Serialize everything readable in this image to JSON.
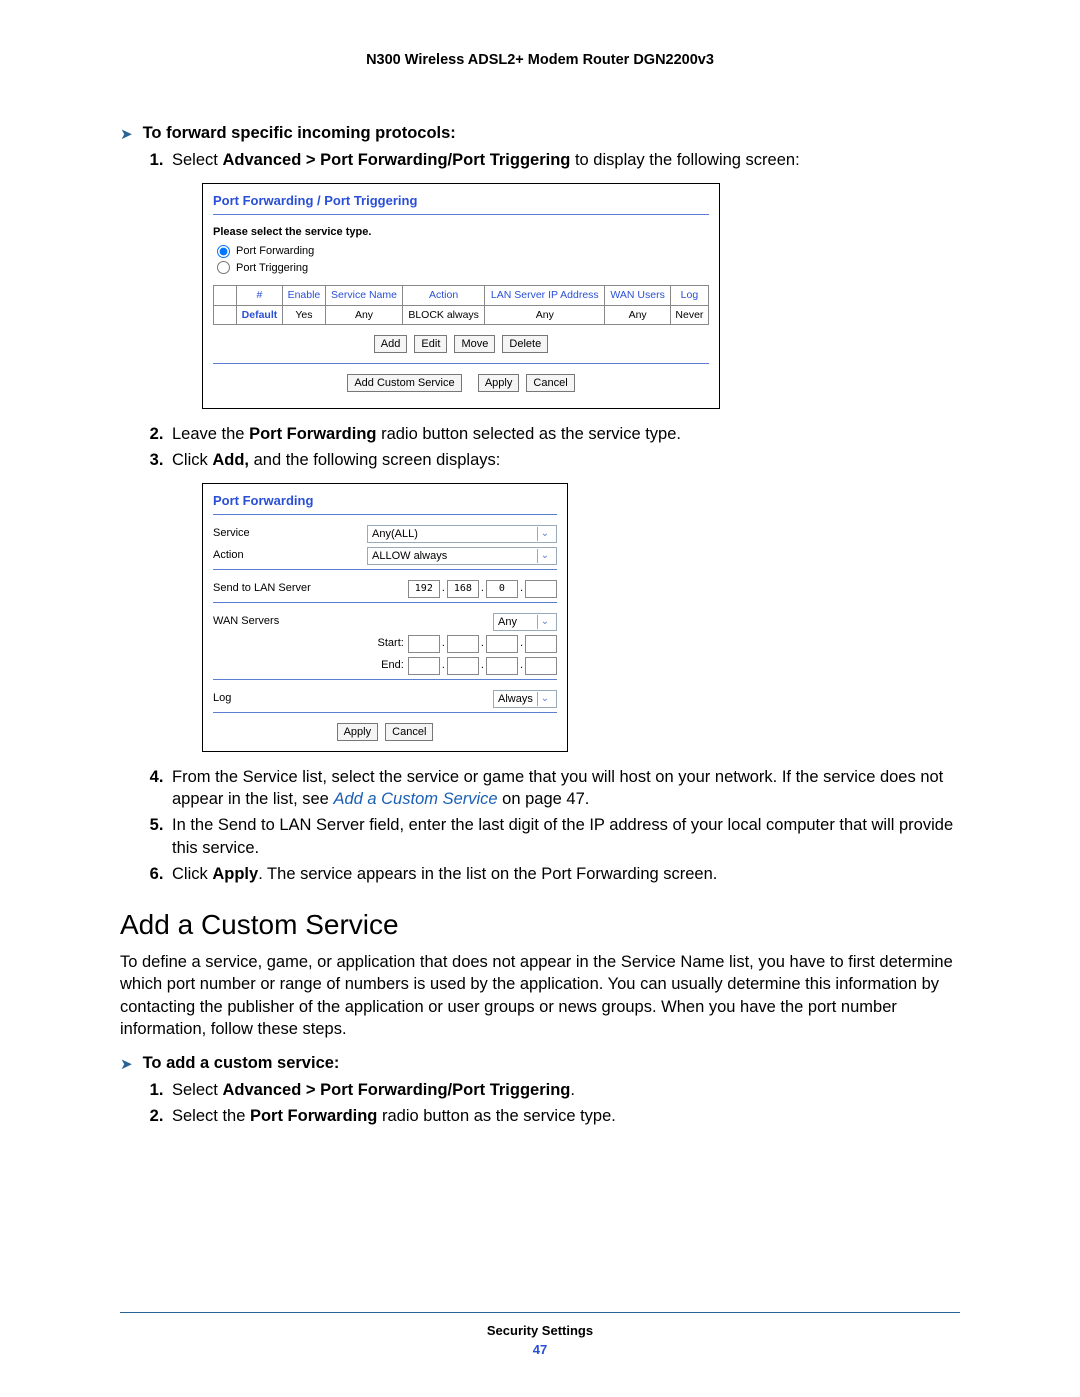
{
  "header": {
    "title": "N300 Wireless ADSL2+ Modem Router DGN2200v3"
  },
  "sec1": {
    "heading": "To forward specific incoming protocols:",
    "step1_a": "Select ",
    "step1_b": "Advanced > Port Forwarding/Port Triggering",
    "step1_c": " to display the following screen:",
    "step2_a": "Leave the ",
    "step2_b": "Port Forwarding",
    "step2_c": " radio button selected as the service type.",
    "step3_a": "Click ",
    "step3_b": "Add,",
    "step3_c": " and the following screen displays:",
    "step4": "From the Service list, select the service or game that you will host on your network. If the service does not appear in the list, see ",
    "step4_link": "Add a Custom Service",
    "step4_tail": " on page 47.",
    "step5": "In the Send to LAN Server field, enter the last digit of the IP address of your local computer that will provide this service.",
    "step6_a": "Click ",
    "step6_b": "Apply",
    "step6_c": ". The service appears in the list on the Port Forwarding screen."
  },
  "panel1": {
    "title": "Port Forwarding / Port Triggering",
    "select_label": "Please select the service type.",
    "radio1": "Port Forwarding",
    "radio2": "Port Triggering",
    "headers": [
      "",
      "#",
      "Enable",
      "Service Name",
      "Action",
      "LAN Server IP Address",
      "WAN Users",
      "Log"
    ],
    "row": [
      "",
      "Default",
      "Yes",
      "Any",
      "BLOCK always",
      "Any",
      "Any",
      "Never"
    ],
    "btns1": [
      "Add",
      "Edit",
      "Move",
      "Delete"
    ],
    "btns2": [
      "Add Custom Service",
      "Apply",
      "Cancel"
    ]
  },
  "panel2": {
    "title": "Port Forwarding",
    "labels": {
      "service": "Service",
      "action": "Action",
      "send": "Send to LAN Server",
      "wan": "WAN Servers",
      "start": "Start:",
      "end": "End:",
      "log": "Log"
    },
    "values": {
      "service": "Any(ALL)",
      "action": "ALLOW always",
      "ip": [
        "192",
        "168",
        "0",
        ""
      ],
      "wan": "Any",
      "log": "Always"
    },
    "btns": [
      "Apply",
      "Cancel"
    ]
  },
  "section2": {
    "title": "Add a Custom Service",
    "para": "To define a service, game, or application that does not appear in the Service Name list, you have to first determine which port number or range of numbers is used by the application. You can usually determine this information by contacting the publisher of the application or user groups or news groups. When you have the port number information, follow these steps."
  },
  "sec2steps": {
    "heading": "To add a custom service:",
    "s1a": "Select ",
    "s1b": "Advanced > Port Forwarding/Port Triggering",
    "s1c": ".",
    "s2a": "Select the ",
    "s2b": "Port Forwarding",
    "s2c": " radio button as the service type."
  },
  "footer": {
    "section": "Security Settings",
    "page": "47"
  }
}
